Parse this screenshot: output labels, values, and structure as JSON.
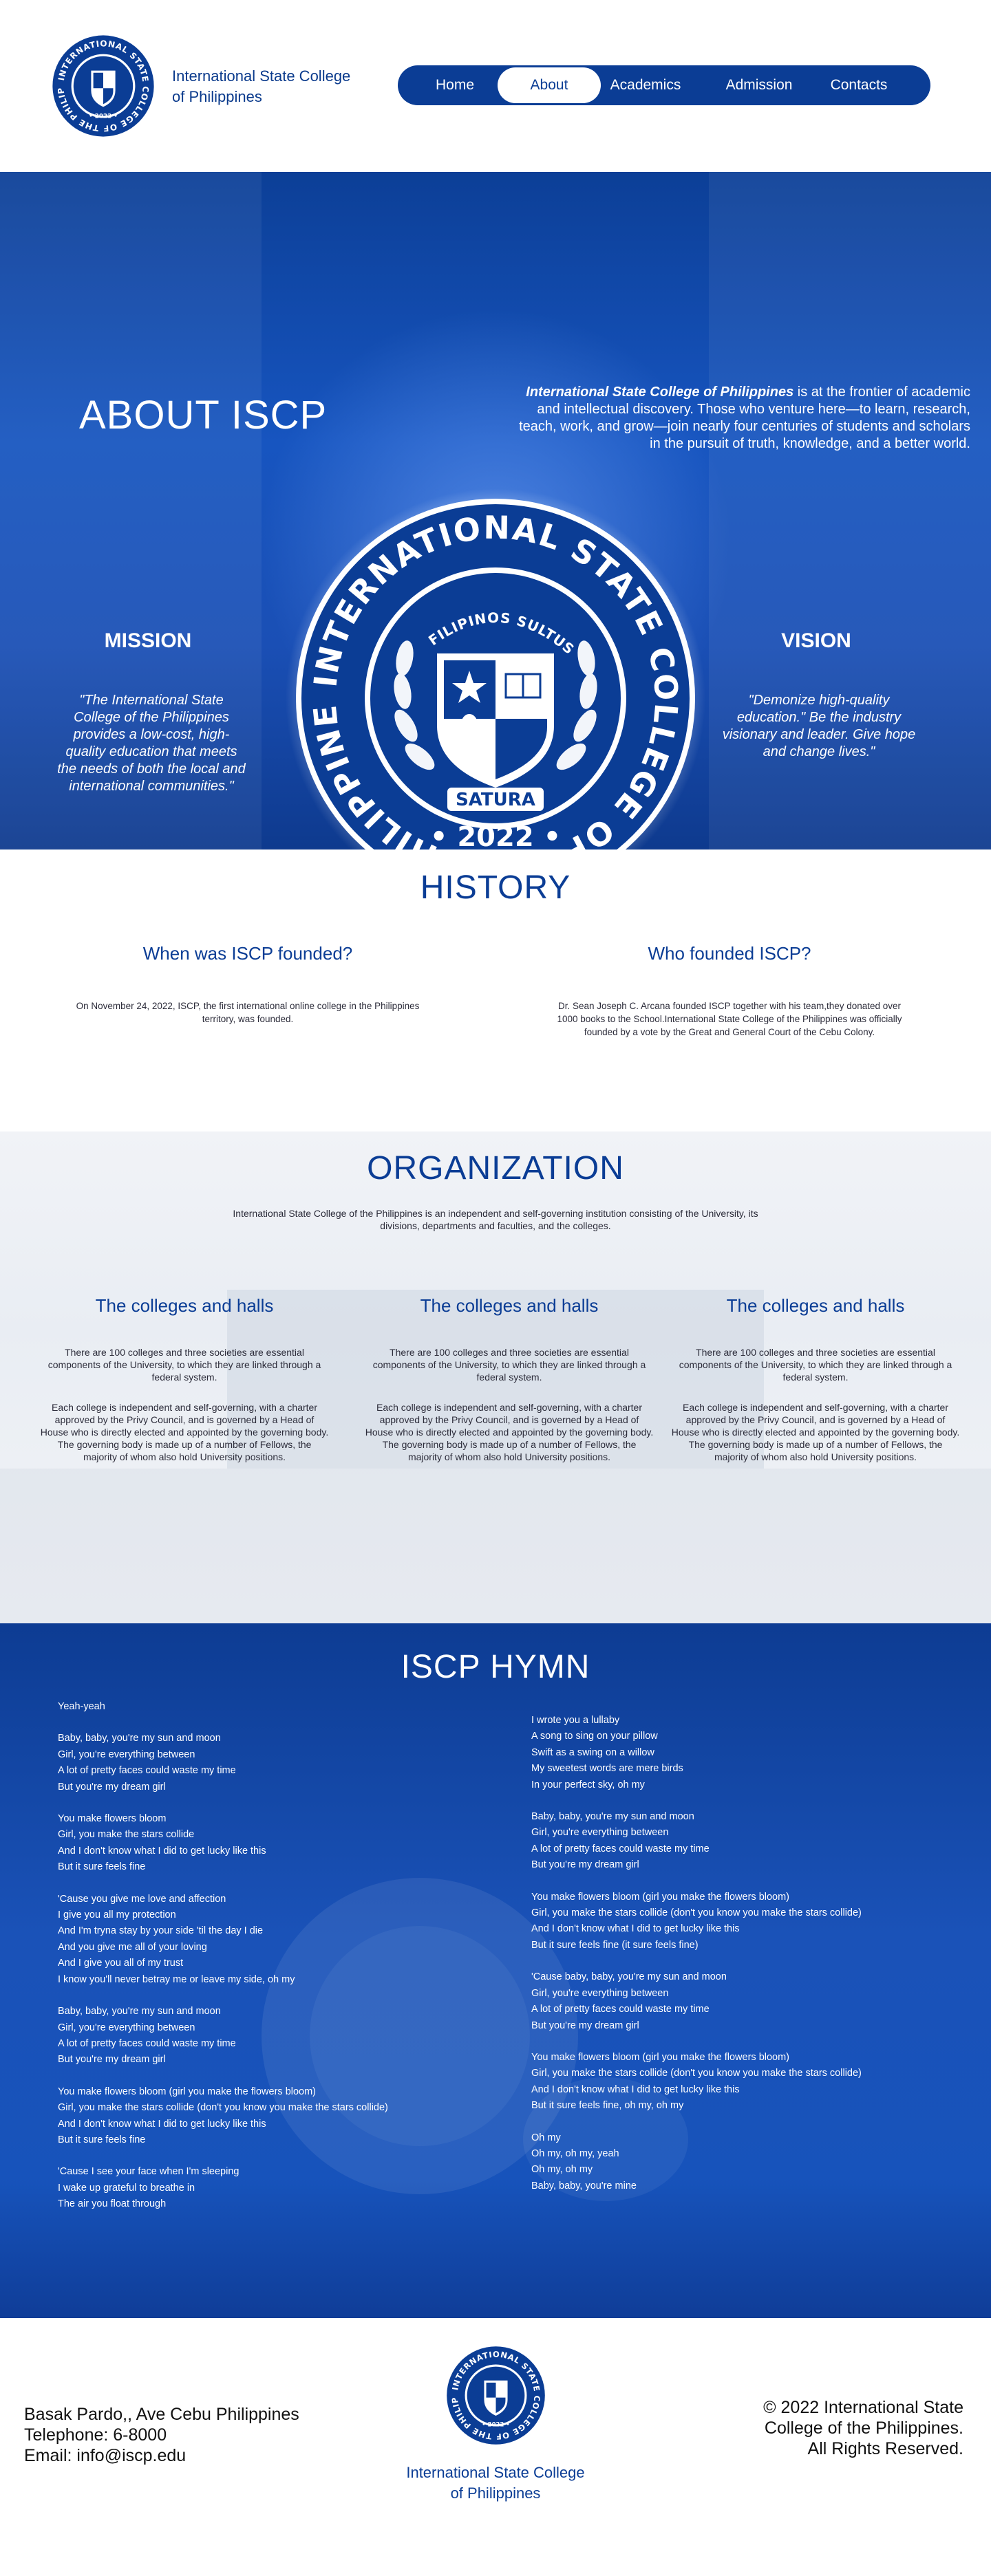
{
  "header": {
    "brand_line1": "International State College",
    "brand_line2": "of Philippines",
    "logo": {
      "ring_text": "INTERNATIONAL STATE COLLEGE OF THE PHILIPPINES",
      "motto": "FILIPINOS SULTUS ES",
      "banner": "SATURA",
      "year": "• 2022 •"
    },
    "nav": [
      {
        "label": "Home"
      },
      {
        "label": "About"
      },
      {
        "label": "Academics"
      },
      {
        "label": "Admission"
      },
      {
        "label": "Contacts"
      }
    ],
    "active_nav": "About"
  },
  "about": {
    "title": "ABOUT ISCP",
    "intro_emphasis": "International State College of Philippines",
    "intro_rest": " is at the frontier of academic and intellectual discovery. Those who venture here—to learn, research, teach, work, and grow—join nearly four centuries of students and scholars in the pursuit of truth, knowledge, and a better world.",
    "mission_title": "MISSION",
    "mission_text": "\"The International State College of the Philippines provides a low-cost, high-quality education that meets the needs of both the local and international communities.\"",
    "vision_title": "VISION",
    "vision_text": "\"Demonize high-quality education.\" Be the industry visionary and leader. Give hope and change lives.\""
  },
  "history": {
    "title": "HISTORY",
    "q1": "When was ISCP founded?",
    "a1": "On November 24, 2022, ISCP, the first international online college in the Philippines territory, was founded.",
    "q2": "Who founded ISCP?",
    "a2": "Dr. Sean Joseph C. Arcana founded ISCP together with his team,they donated over 1000 books to the School.International State College of the Philippines was officially founded by a vote by the Great and General Court of the Cebu Colony."
  },
  "organization": {
    "title": "ORGANIZATION",
    "intro": "International State College of the Philippines is an independent and self-governing institution consisting of the University, its divisions, departments and faculties, and the colleges.",
    "columns": [
      {
        "title": "The colleges and halls",
        "p1": "There are 100 colleges and three societies are essential components of the University, to which they are linked through a federal system.",
        "p2": "Each college is independent and self-governing, with a charter approved by the Privy Council, and is governed by a Head of House who is directly elected and appointed by the governing body. The governing body is made up of a number of Fellows, the majority of whom also hold University positions."
      },
      {
        "title": "The colleges and halls",
        "p1": "There are 100 colleges and three societies are essential components of the University, to which they are linked through a federal system.",
        "p2": "Each college is independent and self-governing, with a charter approved by the Privy Council, and is governed by a Head of House who is directly elected and appointed by the governing body. The governing body is made up of a number of Fellows, the majority of whom also hold University positions."
      },
      {
        "title": "The colleges and halls",
        "p1": "There are 100 colleges and three societies are essential components of the University, to which they are linked through a federal system.",
        "p2": "Each college is independent and self-governing, with a charter approved by the Privy Council, and is governed by a Head of House who is directly elected and appointed by the governing body. The governing body is made up of a number of Fellows, the majority of whom also hold University positions."
      }
    ]
  },
  "hymn": {
    "title": "ISCP HYMN",
    "left": [
      [
        "Yeah-yeah"
      ],
      [
        "Baby, baby, you're my sun and moon",
        "Girl, you're everything between",
        "A lot of pretty faces could waste my time",
        "But you're my dream girl"
      ],
      [
        "You make flowers bloom",
        "Girl, you make the stars collide",
        "And I don't know what I did to get lucky like this",
        "But it sure feels fine"
      ],
      [
        "'Cause you give me love and affection",
        "I give you all my protection",
        "And I'm tryna stay by your side 'til the day I die",
        "And you give me all of your loving",
        "And I give you all of my trust",
        "I know you'll never betray me or leave my side, oh my"
      ],
      [
        "Baby, baby, you're my sun and moon",
        "Girl, you're everything between",
        "A lot of pretty faces could waste my time",
        "But you're my dream girl"
      ],
      [
        "You make flowers bloom (girl you make the flowers bloom)",
        "Girl, you make the stars collide (don't you know you make the stars collide)",
        "And I don't know what I did to get lucky like this",
        "But it sure feels fine"
      ],
      [
        "'Cause I see your face when I'm sleeping",
        "I wake up grateful to breathe in",
        "The air you float through"
      ]
    ],
    "right": [
      [
        "I wrote you a lullaby",
        "A song to sing on your pillow",
        "Swift as a swing on a willow",
        "My sweetest words are mere birds",
        "In your perfect sky, oh my"
      ],
      [
        "Baby, baby, you're my sun and moon",
        "Girl, you're everything between",
        "A lot of pretty faces could waste my time",
        "But you're my dream girl"
      ],
      [
        "You make flowers bloom (girl you make the flowers bloom)",
        "Girl, you make the stars collide (don't you know you make the stars collide)",
        "And I don't know what I did to get lucky like this",
        "But it sure feels fine (it sure feels fine)"
      ],
      [
        "'Cause baby, baby, you're my sun and moon",
        "Girl, you're everything between",
        "A lot of pretty faces could waste my time",
        "But you're my dream girl"
      ],
      [
        "You make flowers bloom (girl you make the flowers bloom)",
        "Girl, you make the stars collide (don't you know you make the stars collide)",
        "And I don't know what I did to get lucky like this",
        "But it sure feels fine, oh my, oh my"
      ],
      [
        "Oh my",
        "Oh my, oh my, yeah",
        "Oh my, oh my",
        "Baby, baby, you're mine"
      ]
    ]
  },
  "footer": {
    "address": "Basak Pardo,, Ave Cebu Philippines",
    "telephone": "Telephone: 6-8000",
    "email": "Email: info@iscp.edu",
    "name_line1": "International State College",
    "name_line2": "of Philippines",
    "copyright_line1": "© 2022 International State",
    "copyright_line2": "College of the Philippines.",
    "copyright_line3": "All Rights Reserved."
  },
  "colors": {
    "primary": "#0b3d95",
    "white": "#ffffff",
    "text_dark": "#2c2c3a"
  }
}
